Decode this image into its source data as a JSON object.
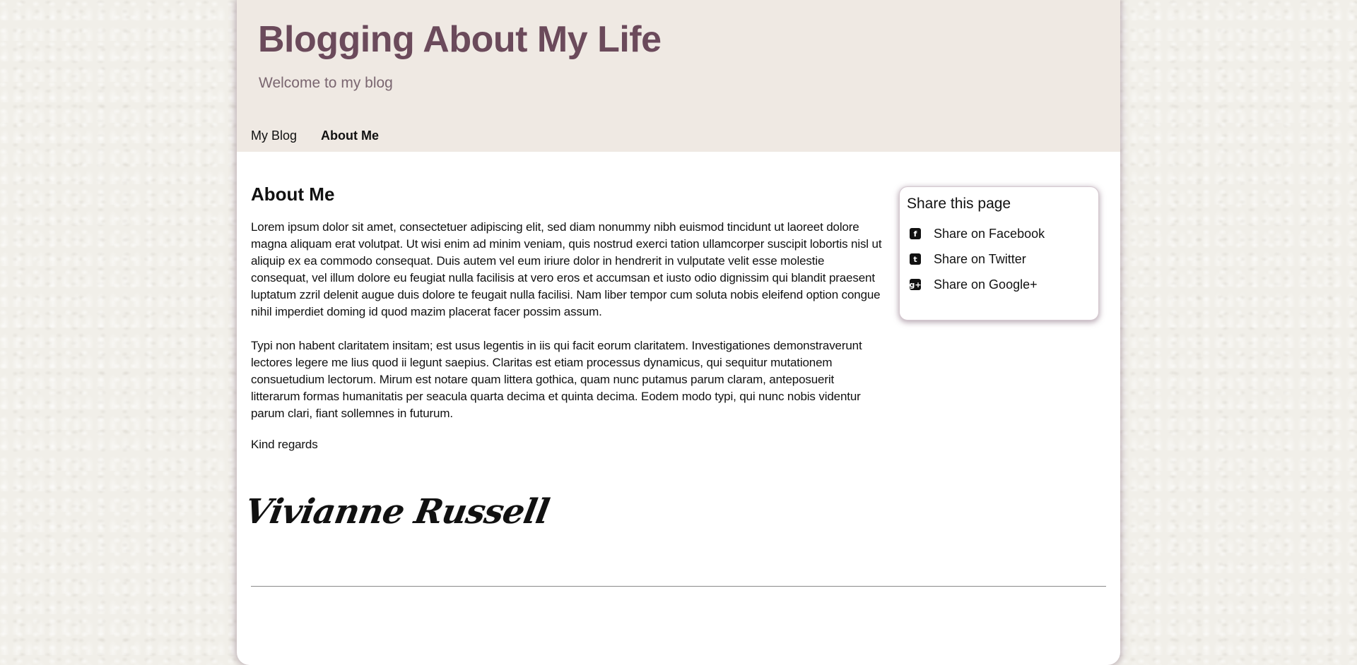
{
  "header": {
    "site_title": "Blogging About My Life",
    "subtitle": "Welcome to my blog"
  },
  "nav": {
    "items": [
      {
        "label": "My Blog",
        "active": false
      },
      {
        "label": "About Me",
        "active": true
      }
    ]
  },
  "main": {
    "heading": "About Me",
    "paragraphs": [
      "Lorem ipsum dolor sit amet, consectetuer adipiscing elit, sed diam nonummy nibh euismod tincidunt ut laoreet dolore magna aliquam erat volutpat. Ut wisi enim ad minim veniam, quis nostrud exerci tation ullamcorper suscipit lobortis nisl ut aliquip ex ea commodo consequat. Duis autem vel eum iriure dolor in hendrerit in vulputate velit esse molestie consequat, vel illum dolore eu feugiat nulla facilisis at vero eros et accumsan et iusto odio dignissim qui blandit praesent luptatum zzril delenit augue duis dolore te feugait nulla facilisi. Nam liber tempor cum soluta nobis eleifend option congue nihil imperdiet doming id quod mazim placerat facer possim assum.",
      "Typi non habent claritatem insitam; est usus legentis in iis qui facit eorum claritatem. Investigationes demonstraverunt lectores legere me lius quod ii legunt saepius. Claritas est etiam processus dynamicus, qui sequitur mutationem consuetudium lectorum. Mirum est notare quam littera gothica, quam nunc putamus parum claram, anteposuerit litterarum formas humanitatis per seacula quarta decima et quinta decima. Eodem modo typi, qui nunc nobis videntur parum clari, fiant sollemnes in futurum."
    ],
    "closing": "Kind regards",
    "signature": "Vivianne Russell"
  },
  "share": {
    "title": "Share this page",
    "items": [
      {
        "label": "Share on Facebook",
        "icon": "facebook-icon",
        "glyph": "f"
      },
      {
        "label": "Share on Twitter",
        "icon": "twitter-icon",
        "glyph": "t"
      },
      {
        "label": "Share on Google+",
        "icon": "google-plus-icon",
        "glyph": "g+"
      }
    ]
  },
  "colors": {
    "title": "#6b4a5b",
    "header_bg": "#efe9e3",
    "page_bg": "#f1efe9"
  }
}
